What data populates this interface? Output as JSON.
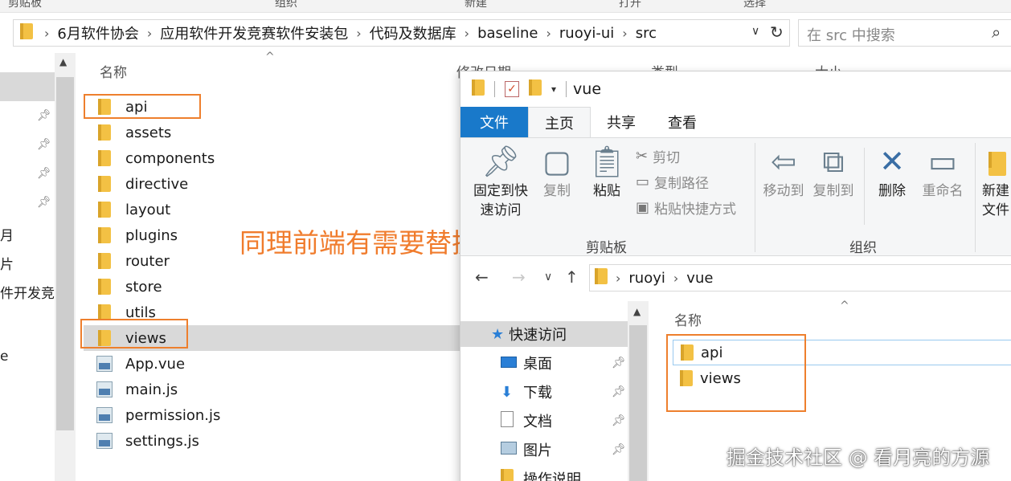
{
  "back_window": {
    "ribbon_group_labels": [
      "剪贴板",
      "组织",
      "新建",
      "打开",
      "选择"
    ],
    "breadcrumbs": [
      "6月软件协会",
      "应用软件开发竞赛软件安装包",
      "代码及数据库",
      "baseline",
      "ruoyi-ui",
      "src"
    ],
    "search_placeholder": "在 src 中搜索",
    "column_headers": {
      "name": "名称",
      "modified": "修改日期",
      "type": "类型",
      "size": "大小"
    },
    "nav_fragments": [
      "月",
      "片",
      "件开发竞赛",
      "e",
      "̲"
    ],
    "files": [
      {
        "name": "api",
        "kind": "folder"
      },
      {
        "name": "assets",
        "kind": "folder"
      },
      {
        "name": "components",
        "kind": "folder"
      },
      {
        "name": "directive",
        "kind": "folder"
      },
      {
        "name": "layout",
        "kind": "folder"
      },
      {
        "name": "plugins",
        "kind": "folder"
      },
      {
        "name": "router",
        "kind": "folder"
      },
      {
        "name": "store",
        "kind": "folder"
      },
      {
        "name": "utils",
        "kind": "folder"
      },
      {
        "name": "views",
        "kind": "folder",
        "selected": true
      },
      {
        "name": "App.vue",
        "kind": "file"
      },
      {
        "name": "main.js",
        "kind": "file"
      },
      {
        "name": "permission.js",
        "kind": "file"
      },
      {
        "name": "settings.js",
        "kind": "file"
      }
    ]
  },
  "annotation": "同理前端有需要替换代码",
  "front_window": {
    "title": "vue",
    "tabs": [
      "文件",
      "主页",
      "共享",
      "查看"
    ],
    "ribbon": {
      "pin_quick_access": "固定到快速访问",
      "copy": "复制",
      "paste": "粘贴",
      "cut": "剪切",
      "copy_path": "复制路径",
      "paste_shortcut": "粘贴快捷方式",
      "clipboard_group": "剪贴板",
      "move_to": "移动到",
      "copy_to": "复制到",
      "delete": "删除",
      "rename": "重命名",
      "organize_group": "组织",
      "new_folder": "新建文件"
    },
    "breadcrumbs": [
      "ruoyi",
      "vue"
    ],
    "nav": {
      "quick_access": "快速访问",
      "items": [
        "桌面",
        "下载",
        "文档",
        "图片",
        "操作说明"
      ]
    },
    "list_header": "名称",
    "files": [
      "api",
      "views"
    ]
  },
  "watermark": "掘金技术社区 @ 看月亮的方源",
  "colors": {
    "accent_orange": "#ee7f2d",
    "file_tab_blue": "#1979ca",
    "folder_yellow": "#f3c144"
  }
}
